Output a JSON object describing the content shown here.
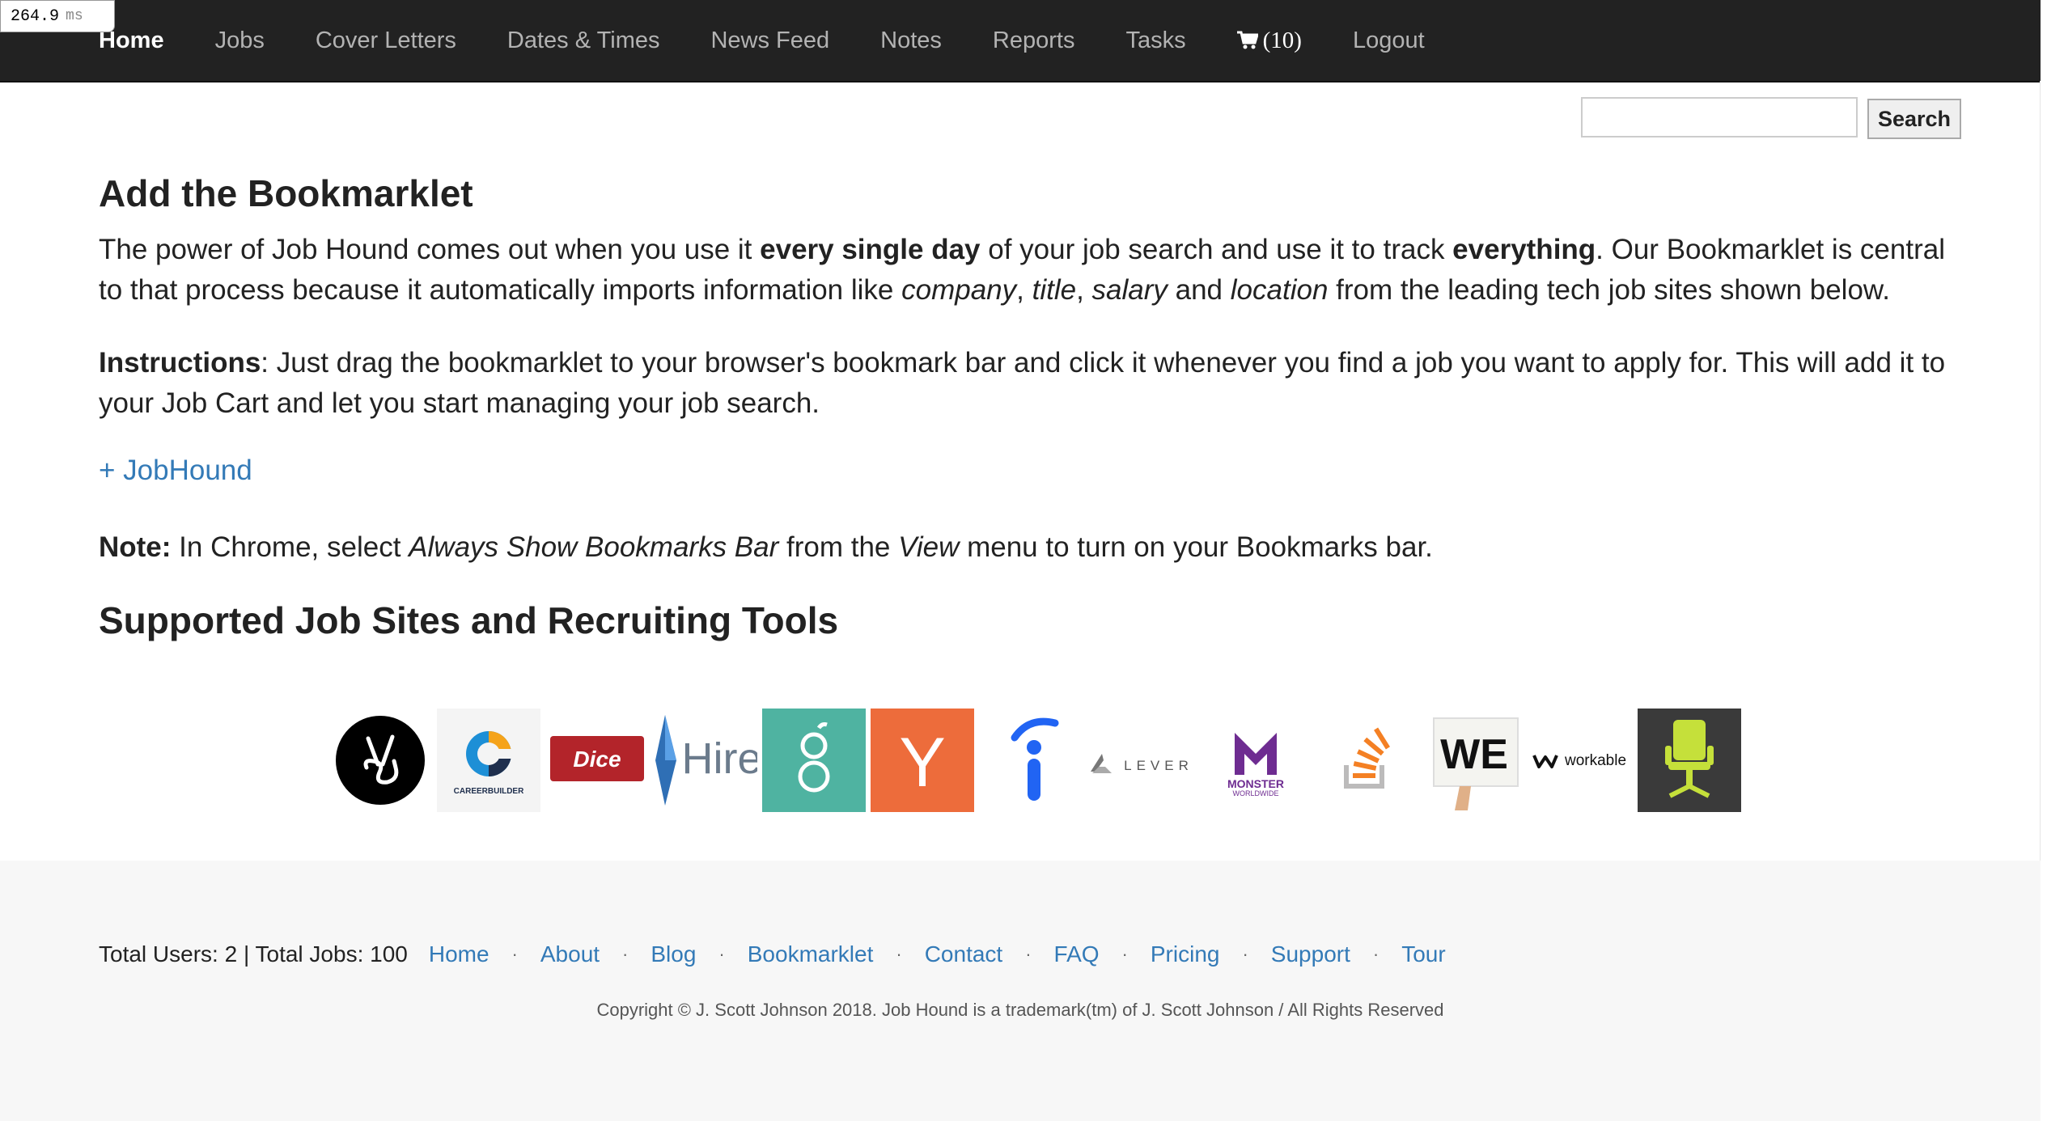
{
  "timing": {
    "value": "264.9",
    "unit": "ms"
  },
  "nav": {
    "items": [
      "Home",
      "Jobs",
      "Cover Letters",
      "Dates & Times",
      "News Feed",
      "Notes",
      "Reports",
      "Tasks"
    ],
    "cart_count": "(10)",
    "logout": "Logout"
  },
  "search": {
    "placeholder": "",
    "button_label": "Search"
  },
  "bookmarklet": {
    "title": "Add the Bookmarklet",
    "p1": {
      "t1": "The power of Job Hound comes out when you use it ",
      "b1": "every single day",
      "t2": " of your job search and use it to track ",
      "b2": "everything",
      "t3": ". Our Bookmarklet is central to that process because it automatically imports information like ",
      "i1": "company",
      "t4": ", ",
      "i2": "title",
      "t5": ", ",
      "i3": "salary",
      "t6": " and ",
      "i4": "location",
      "t7": " from the leading tech job sites shown below."
    },
    "p2": {
      "b1": "Instructions",
      "t1": ": Just drag the bookmarklet to your browser's bookmark bar and click it whenever you find a job you want to apply for. This will add it to your Job Cart and let you start managing your job search."
    },
    "link_label": "+ JobHound",
    "note": {
      "b1": "Note:",
      "t1": " In Chrome, select ",
      "i1": "Always Show Bookmarks Bar",
      "t2": " from the ",
      "i2": "View",
      "t3": " menu to turn on your Bookmarks bar."
    }
  },
  "supported": {
    "title": "Supported Job Sites and Recruiting Tools",
    "logos": [
      {
        "icon": "angellist-logo"
      },
      {
        "icon": "careerbuilder-logo",
        "text": "CAREERBUILDER"
      },
      {
        "icon": "dice-logo",
        "text": "Dice"
      },
      {
        "icon": "hired-logo",
        "text": "Hire"
      },
      {
        "icon": "greenhouse-logo"
      },
      {
        "icon": "ycombinator-logo",
        "text": "Y"
      },
      {
        "icon": "indeed-logo"
      },
      {
        "icon": "lever-logo",
        "text": "LEVER"
      },
      {
        "icon": "monster-logo",
        "text": "MONSTER",
        "text2": "WORLDWIDE"
      },
      {
        "icon": "stackoverflow-logo"
      },
      {
        "icon": "weworkremotely-logo",
        "text": "WE"
      },
      {
        "icon": "workable-logo",
        "text": "workable"
      },
      {
        "icon": "chair-logo"
      }
    ]
  },
  "footer": {
    "stats": "Total Users: 2 | Total Jobs: 100",
    "links": [
      "Home",
      "About",
      "Blog",
      "Bookmarklet",
      "Contact",
      "FAQ",
      "Pricing",
      "Support",
      "Tour"
    ],
    "separator": "·",
    "copyright": "Copyright © J. Scott Johnson 2018. Job Hound is a trademark(tm) of J. Scott Johnson / All Rights Reserved"
  },
  "colors": {
    "navbar": "#222222",
    "link": "#337ab7",
    "footer_bg": "#f7f7f7",
    "ycombinator": "#ed6c3b",
    "greenhouse": "#4fb3a1",
    "dice": "#b3242a",
    "monster": "#6e2c91"
  }
}
